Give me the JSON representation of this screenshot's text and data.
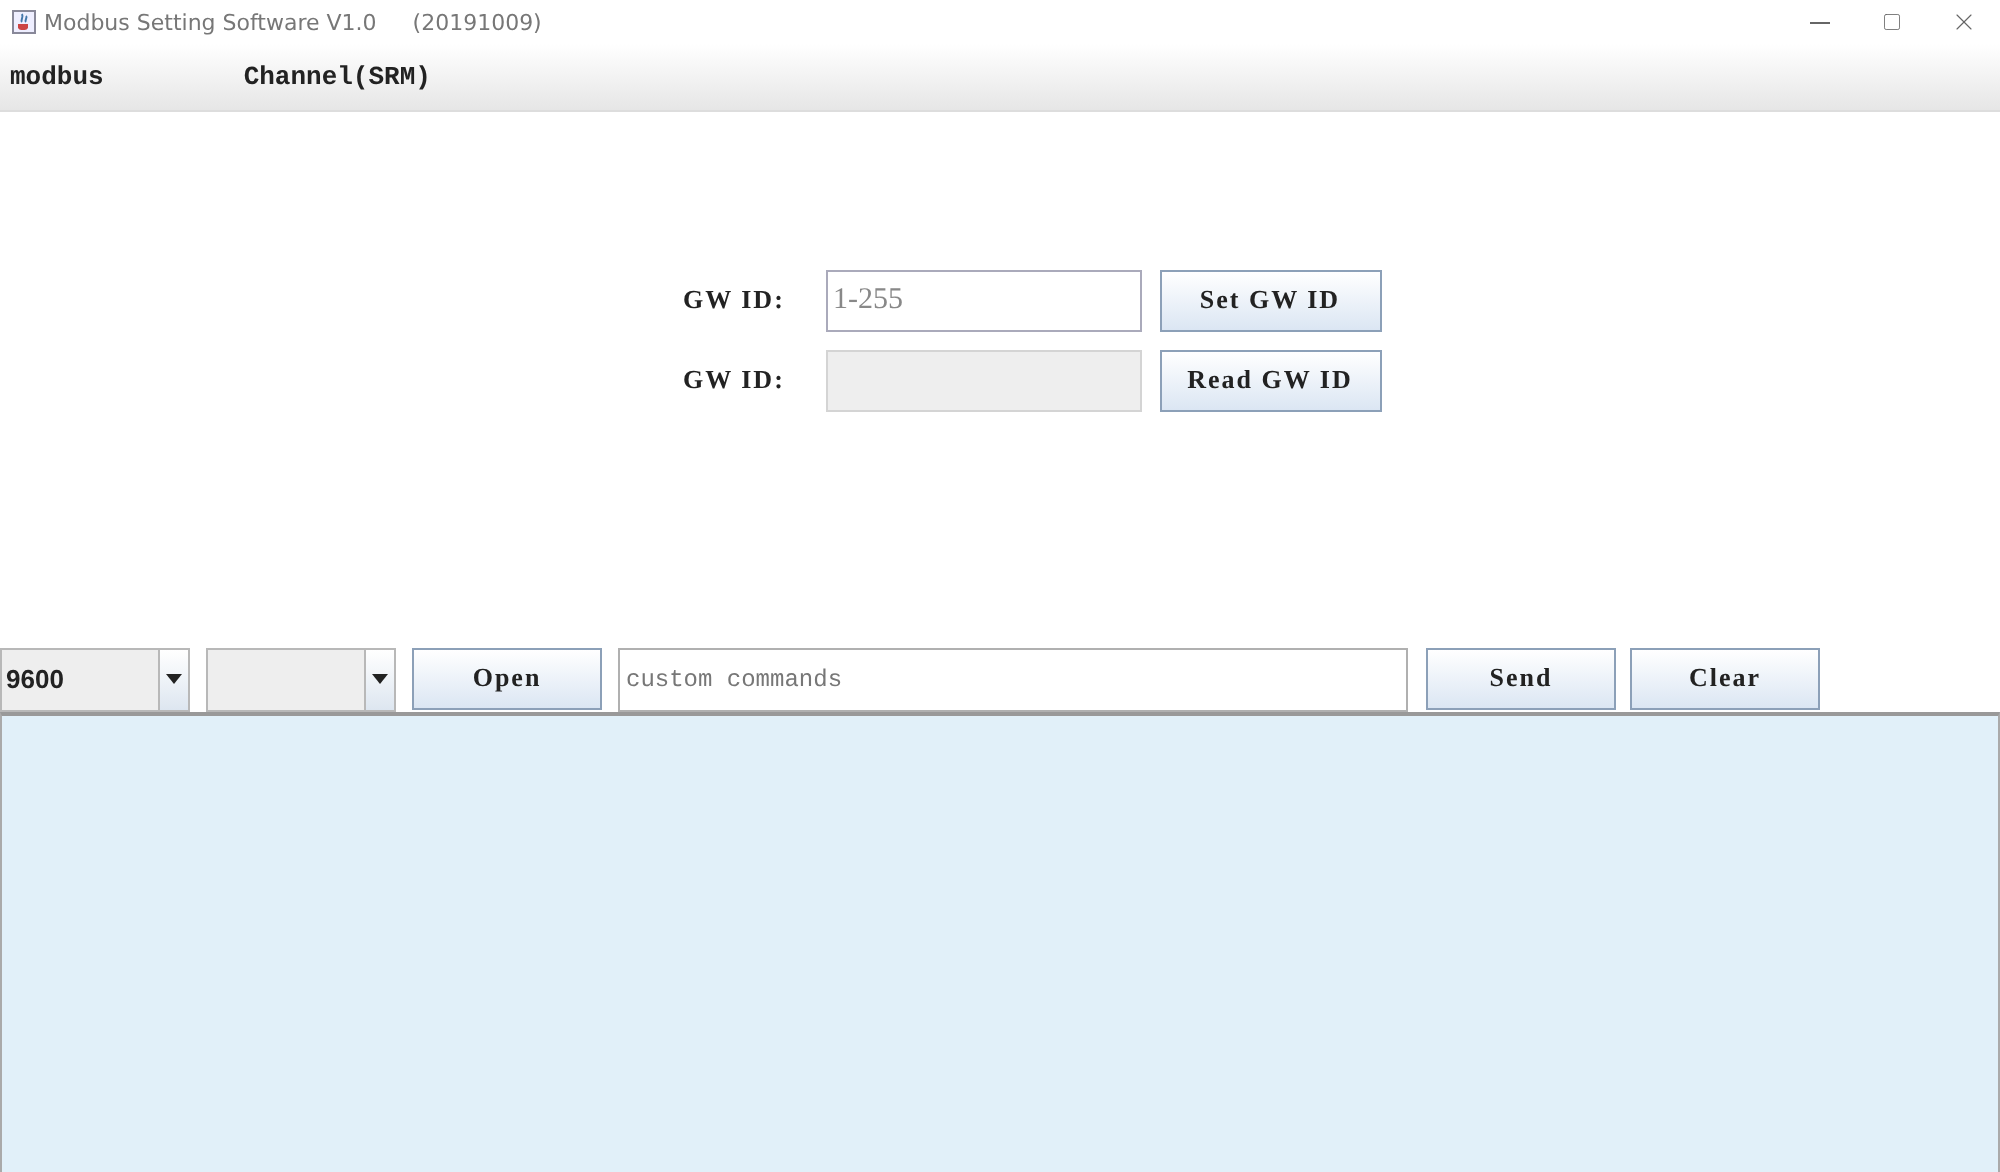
{
  "window": {
    "title": "Modbus Setting Software V1.0",
    "build": "(20191009)"
  },
  "menu": [
    {
      "label": "modbus"
    },
    {
      "label": "Channel(SRM)"
    }
  ],
  "gateway_rows": [
    {
      "label": "GW ID:",
      "placeholder": "1-255",
      "disabled": false,
      "button": "Set GW ID"
    },
    {
      "label": "GW ID:",
      "disabled": true,
      "button": "Read GW ID"
    }
  ],
  "toolbar": {
    "baud_rate": {
      "value": "9600"
    },
    "open_button": "Open",
    "command": {
      "placeholder": "custom commands"
    },
    "send_button": "Send",
    "clear_button": "Clear"
  }
}
